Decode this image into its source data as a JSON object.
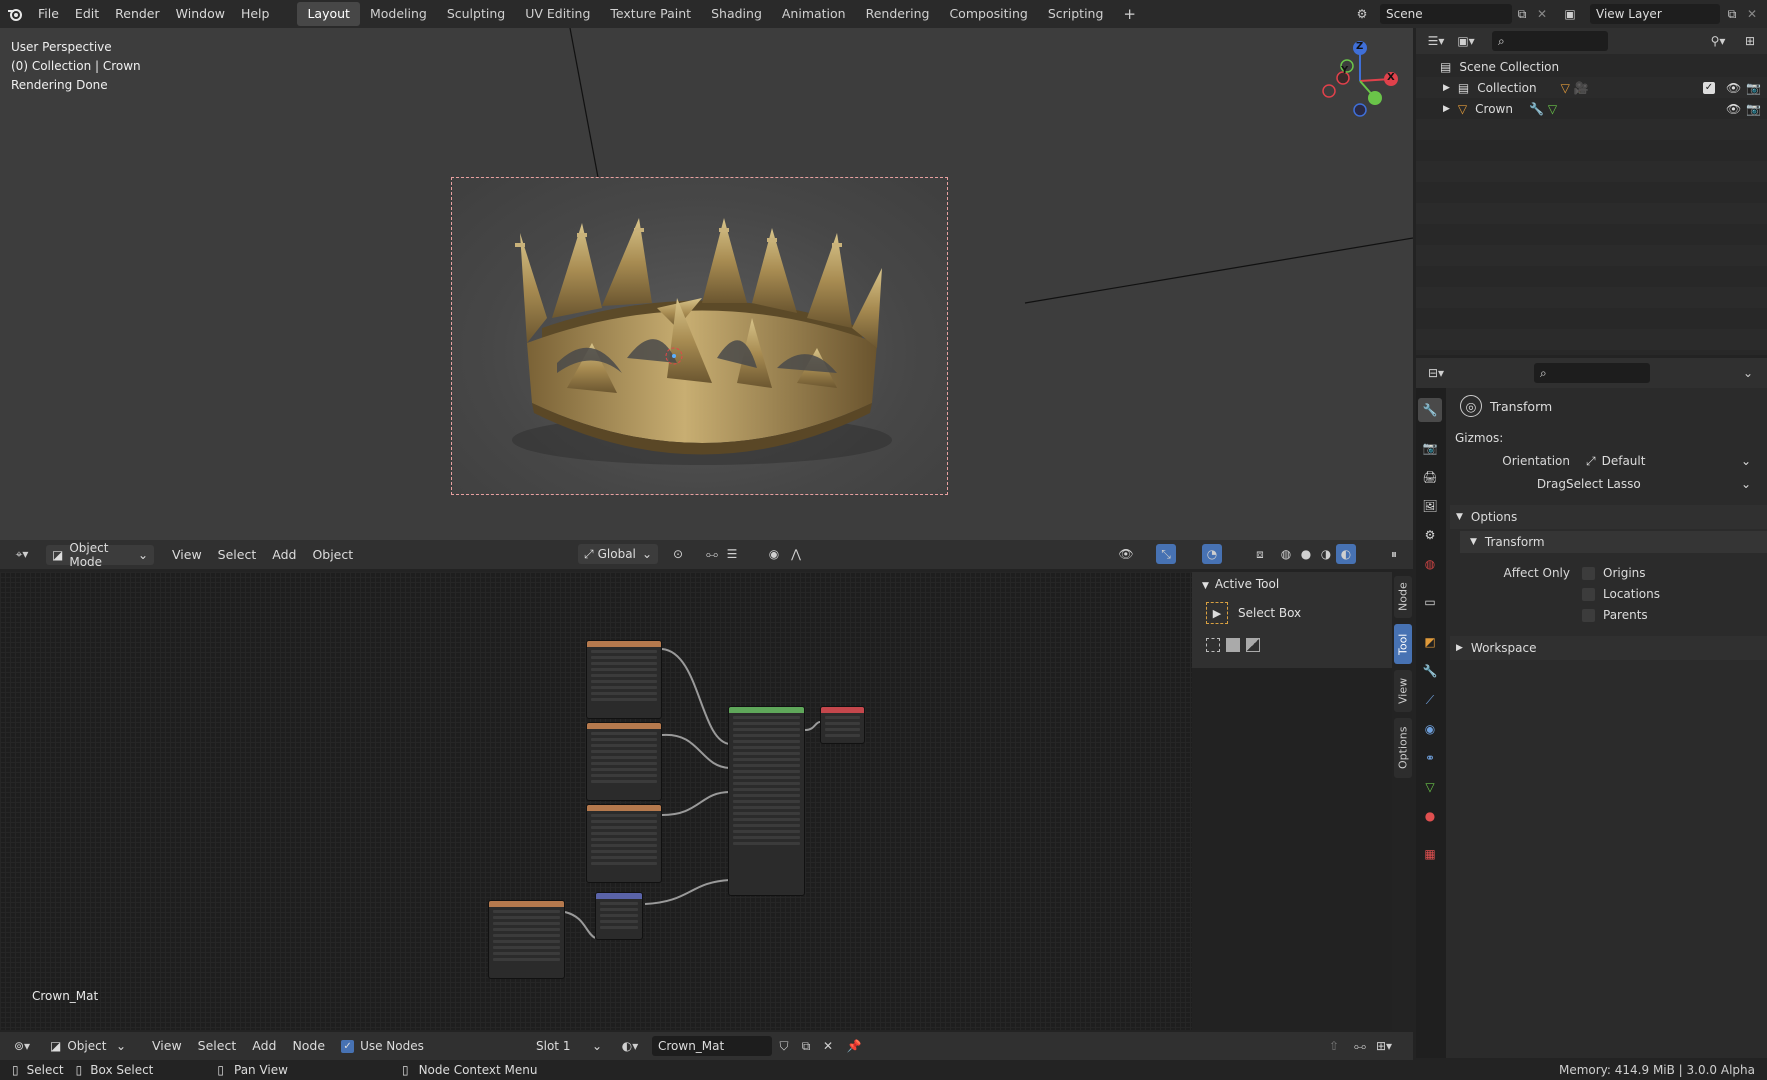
{
  "topbar": {
    "menus": [
      "File",
      "Edit",
      "Render",
      "Window",
      "Help"
    ],
    "workspaces": [
      "Layout",
      "Modeling",
      "Sculpting",
      "UV Editing",
      "Texture Paint",
      "Shading",
      "Animation",
      "Rendering",
      "Compositing",
      "Scripting"
    ],
    "add_tab": "+",
    "scene": "Scene",
    "view_layer": "View Layer"
  },
  "viewport": {
    "info": [
      "User Perspective",
      "(0) Collection | Crown",
      "Rendering Done"
    ],
    "gizmo_axes": {
      "x": "X",
      "y": "Y",
      "z": "Z"
    },
    "header": {
      "mode": "Object Mode",
      "menus": [
        "View",
        "Select",
        "Add",
        "Object"
      ],
      "transform": "Global"
    }
  },
  "outliner": {
    "root": "Scene Collection",
    "items": [
      {
        "name": "Collection"
      },
      {
        "name": "Crown"
      }
    ]
  },
  "properties": {
    "panel_title": "Transform",
    "gizmos_label": "Gizmos:",
    "orientation_label": "Orientation",
    "orientation_value": "Default",
    "drag_label": "Drag:",
    "drag_value": "Select Lasso",
    "options_label": "Options",
    "transform_sub": "Transform",
    "affect_only_label": "Affect Only",
    "affect_options": [
      "Origins",
      "Locations",
      "Parents"
    ],
    "workspace_label": "Workspace"
  },
  "node_editor": {
    "material_label": "Crown_Mat",
    "sidebar": {
      "panel": "Active Tool",
      "tool": "Select Box",
      "tabs": [
        "Node",
        "Tool",
        "View",
        "Options"
      ]
    },
    "header": {
      "type": "Object",
      "menus": [
        "View",
        "Select",
        "Add",
        "Node"
      ],
      "use_nodes": "Use Nodes",
      "slot": "Slot 1",
      "material": "Crown_Mat"
    }
  },
  "statusbar": {
    "items": [
      {
        "label": "Select"
      },
      {
        "label": "Box Select"
      },
      {
        "label": "Pan View"
      },
      {
        "label": "Node Context Menu"
      }
    ],
    "memory": "Memory: 414.9 MiB | 3.0.0 Alpha"
  },
  "colors": {
    "accent": "#4772b3",
    "x_axis": "#e0414b",
    "y_axis": "#6ac449",
    "z_axis": "#3f6fd8",
    "node_image": "#b5794d",
    "node_bsdf": "#5fa75a",
    "node_output": "#c4474c",
    "node_normal": "#5a63a8"
  }
}
